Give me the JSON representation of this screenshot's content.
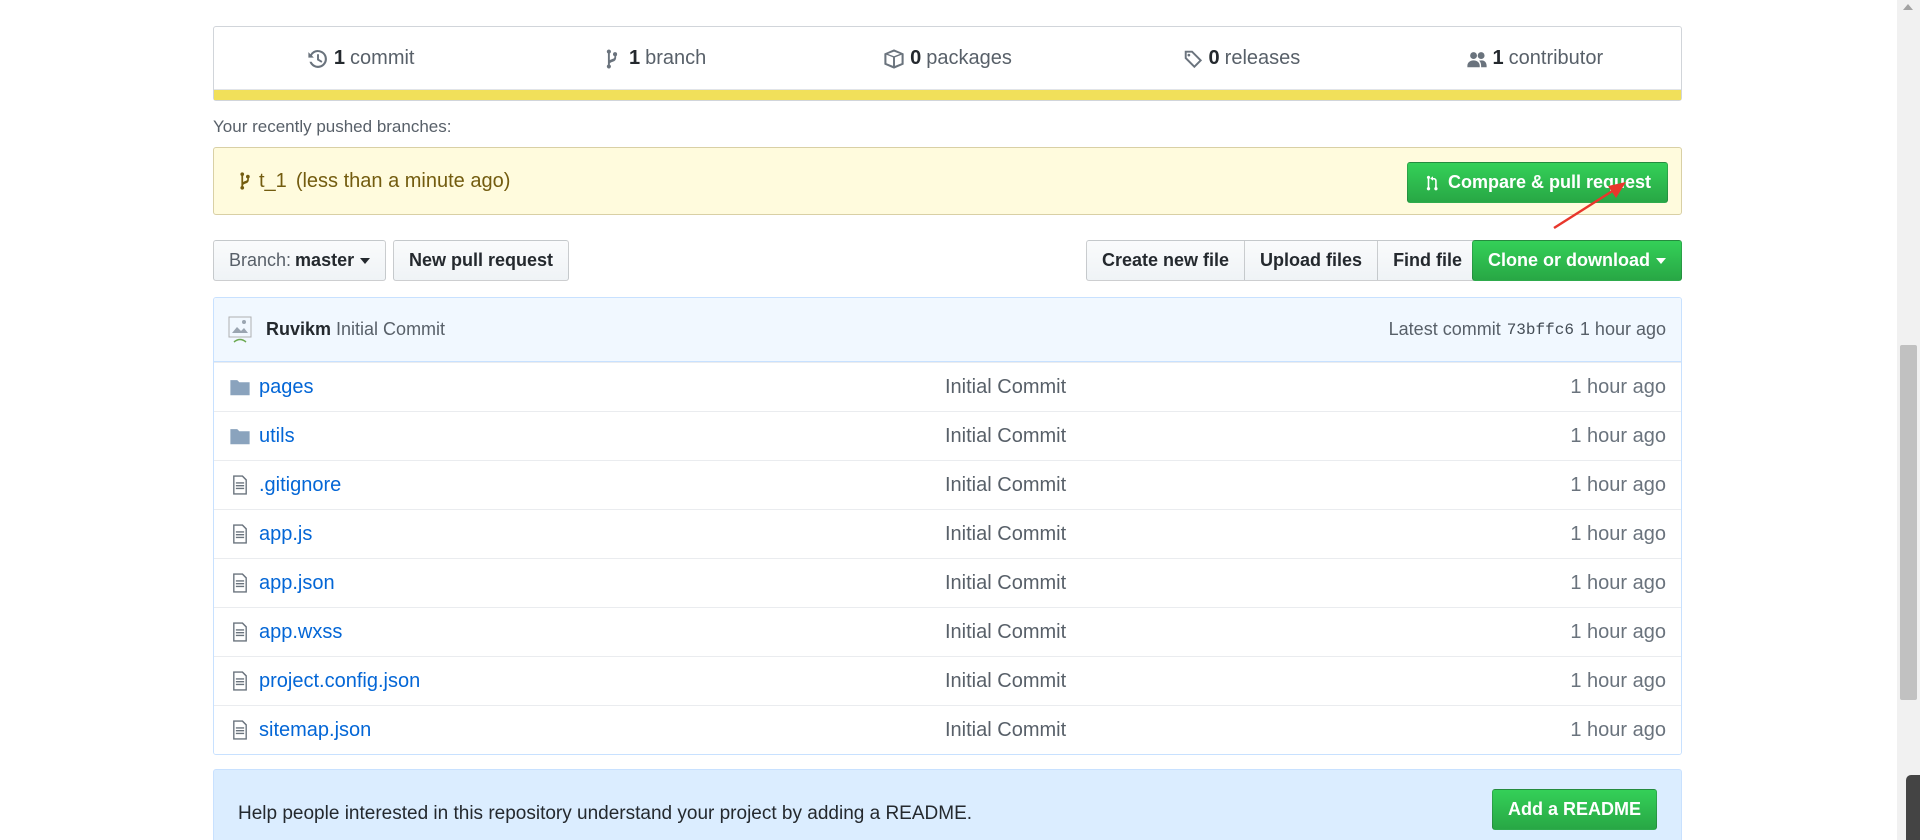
{
  "summary": {
    "commits": {
      "count": "1",
      "label": "commit",
      "icon": "history-icon"
    },
    "branches": {
      "count": "1",
      "label": "branch",
      "icon": "git-branch-icon"
    },
    "packages": {
      "count": "0",
      "label": "packages",
      "icon": "package-icon"
    },
    "releases": {
      "count": "0",
      "label": "releases",
      "icon": "tag-icon"
    },
    "contributors": {
      "count": "1",
      "label": "contributor",
      "icon": "people-icon"
    },
    "language_color": "#f1e05a"
  },
  "recent": {
    "label": "Your recently pushed branches:",
    "branch": "t_1",
    "time": "(less than a minute ago)",
    "compare_button": "Compare & pull request"
  },
  "nav": {
    "branch_prefix": "Branch:",
    "branch_name": "master",
    "new_pr": "New pull request",
    "create_file": "Create new file",
    "upload_files": "Upload files",
    "find_file": "Find file",
    "clone": "Clone or download"
  },
  "latest_commit": {
    "author": "Ruvikm",
    "message": "Initial Commit",
    "label": "Latest commit",
    "sha": "73bffc6",
    "age": "1 hour ago"
  },
  "files": [
    {
      "type": "dir",
      "name": "pages",
      "message": "Initial Commit",
      "age": "1 hour ago"
    },
    {
      "type": "dir",
      "name": "utils",
      "message": "Initial Commit",
      "age": "1 hour ago"
    },
    {
      "type": "file",
      "name": ".gitignore",
      "message": "Initial Commit",
      "age": "1 hour ago"
    },
    {
      "type": "file",
      "name": "app.js",
      "message": "Initial Commit",
      "age": "1 hour ago"
    },
    {
      "type": "file",
      "name": "app.json",
      "message": "Initial Commit",
      "age": "1 hour ago"
    },
    {
      "type": "file",
      "name": "app.wxss",
      "message": "Initial Commit",
      "age": "1 hour ago"
    },
    {
      "type": "file",
      "name": "project.config.json",
      "message": "Initial Commit",
      "age": "1 hour ago"
    },
    {
      "type": "file",
      "name": "sitemap.json",
      "message": "Initial Commit",
      "age": "1 hour ago"
    }
  ],
  "readme": {
    "text": "Help people interested in this repository understand your project by adding a README.",
    "button": "Add a README"
  },
  "colors": {
    "primary_green": "#28a745",
    "link_blue": "#0366d6",
    "annotation_red": "#e8372c"
  }
}
